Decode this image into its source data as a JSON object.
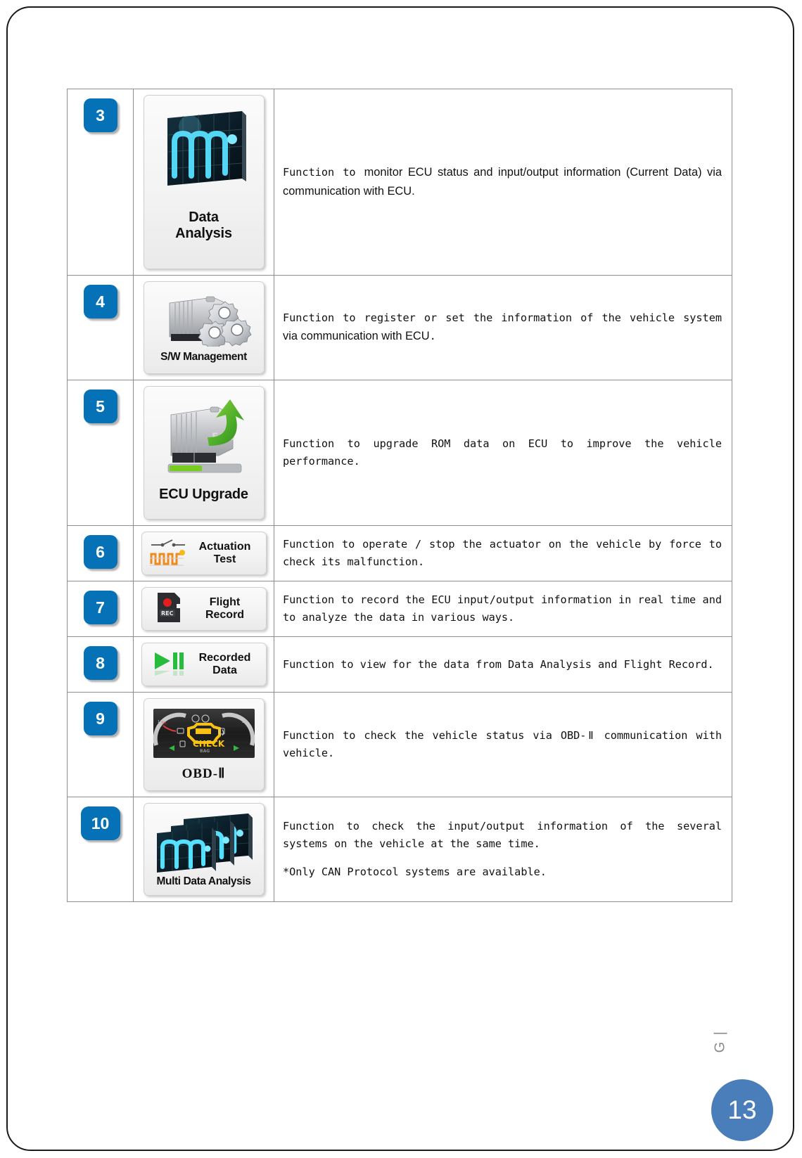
{
  "page": {
    "side_mark": "G |",
    "page_number": "13",
    "badge_color": "#0572b8",
    "page_circle_color": "#4a7ebb"
  },
  "rows": [
    {
      "number": "3",
      "icon_name": "data-analysis-icon",
      "tile_label_line1": "Data",
      "tile_label_line2": "Analysis",
      "desc_mono_prefix": "Function to ",
      "desc_sans": "monitor ECU status and input/output information (Current Data) via communication with ECU.",
      "desc_note": ""
    },
    {
      "number": "4",
      "icon_name": "sw-management-icon",
      "tile_label_line1": "S/W Management",
      "tile_label_line2": "",
      "desc_mono_prefix": "Function to register or set the information of the vehicle system ",
      "desc_sans": "via communication with ECU",
      "desc_mono_suffix": ".",
      "desc_note": ""
    },
    {
      "number": "5",
      "icon_name": "ecu-upgrade-icon",
      "tile_label_line1": "ECU Upgrade",
      "tile_label_line2": "",
      "desc_mono_prefix": "Function to upgrade ROM data on ECU to improve the vehicle performance.",
      "desc_sans": "",
      "desc_note": ""
    },
    {
      "number": "6",
      "icon_name": "actuation-test-icon",
      "tile_label_line1": "Actuation",
      "tile_label_line2": "Test",
      "desc_mono_prefix": "Function to operate / stop the actuator on the vehicle by force to check its malfunction.",
      "desc_sans": "",
      "desc_note": ""
    },
    {
      "number": "7",
      "icon_name": "flight-record-icon",
      "tile_label_line1": "Flight",
      "tile_label_line2": "Record",
      "desc_mono_prefix": "Function to record the ECU input/output information in real time and to analyze the data in various ways.",
      "desc_sans": "",
      "desc_note": ""
    },
    {
      "number": "8",
      "icon_name": "recorded-data-icon",
      "tile_label_line1": "Recorded",
      "tile_label_line2": "Data",
      "desc_mono_prefix": "Function to view for the data from Data Analysis and Flight Record.",
      "desc_sans": "",
      "desc_note": ""
    },
    {
      "number": "9",
      "icon_name": "obd-ii-icon",
      "tile_label_line1": "OBD-Ⅱ",
      "tile_label_line2": "",
      "desc_mono_prefix": "Function to check the vehicle status via OBD-Ⅱ communication with vehicle.",
      "desc_sans": "",
      "desc_note": ""
    },
    {
      "number": "10",
      "icon_name": "multi-data-analysis-icon",
      "tile_label_line1": "Multi Data Analysis",
      "tile_label_line2": "",
      "desc_mono_prefix": "Function to check the input/output information of the several systems on the vehicle at the same time.",
      "desc_sans": "",
      "desc_note": "*Only CAN Protocol systems are available."
    }
  ]
}
